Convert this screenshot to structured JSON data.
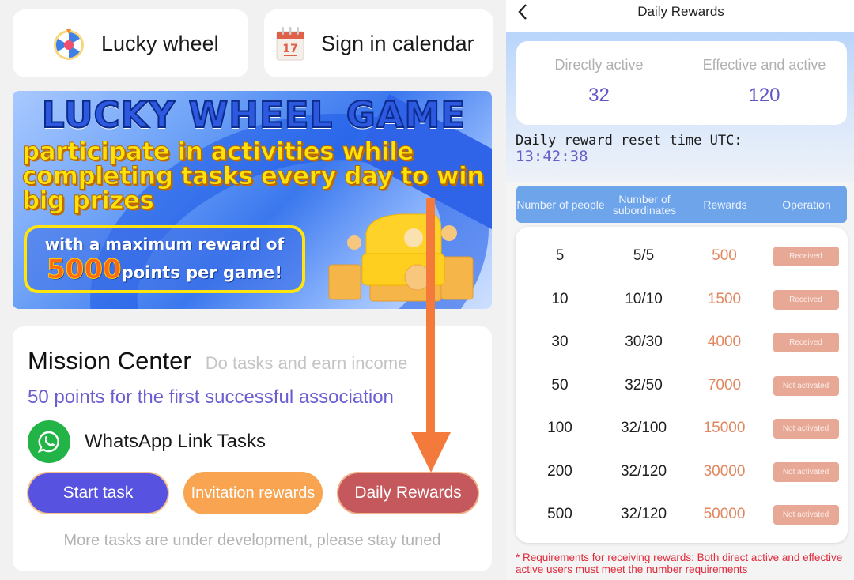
{
  "left": {
    "quick_links": [
      {
        "label": "Lucky wheel",
        "icon": "lucky-wheel-icon"
      },
      {
        "label": "Sign in calendar",
        "icon": "calendar-icon",
        "icon_text": "17"
      }
    ],
    "banner": {
      "title": "LUCKY WHEEL GAME",
      "slogan": "participate in activities while completing tasks every day to win big prizes",
      "promo_line1": "with a maximum reward of",
      "promo_amount": "5000",
      "promo_line2_suffix": "points per game!"
    },
    "mission": {
      "title": "Mission Center",
      "subtitle": "Do tasks and earn income",
      "note": "50 points for the first successful association",
      "task_label": "WhatsApp Link Tasks",
      "task_icon": "whatsapp-icon",
      "buttons": {
        "start": "Start task",
        "invite": "Invitation rewards",
        "daily": "Daily Rewards"
      },
      "footer": "More tasks are under development, please stay tuned"
    },
    "annotation_color": "#f47a3c"
  },
  "right": {
    "header": {
      "title": "Daily Rewards",
      "back_icon": "chevron-left-icon"
    },
    "stats": [
      {
        "label": "Directly active",
        "value": "32"
      },
      {
        "label": "Effective and active",
        "value": "120"
      }
    ],
    "reset_label": "Daily reward reset time UTC:",
    "reset_time": "13:42:38",
    "table": {
      "columns": [
        "Number of people",
        "Number of subordinates",
        "Rewards",
        "Operation"
      ],
      "rows": [
        {
          "people": "5",
          "subordinates": "5/5",
          "reward": "500",
          "status": "Received"
        },
        {
          "people": "10",
          "subordinates": "10/10",
          "reward": "1500",
          "status": "Received"
        },
        {
          "people": "30",
          "subordinates": "30/30",
          "reward": "4000",
          "status": "Received"
        },
        {
          "people": "50",
          "subordinates": "32/50",
          "reward": "7000",
          "status": "Not activated"
        },
        {
          "people": "100",
          "subordinates": "32/100",
          "reward": "15000",
          "status": "Not activated"
        },
        {
          "people": "200",
          "subordinates": "32/120",
          "reward": "30000",
          "status": "Not activated"
        },
        {
          "people": "500",
          "subordinates": "32/120",
          "reward": "50000",
          "status": "Not activated"
        }
      ]
    },
    "requirement_note": "* Requirements for receiving rewards: Both direct active and effective active users must meet the number requirements",
    "colors": {
      "accent_purple": "#6257c6",
      "table_header": "#6ea4ea",
      "reward_orange": "#e0875f",
      "badge": "#e8a896",
      "warning_red": "#e12a3a"
    }
  }
}
